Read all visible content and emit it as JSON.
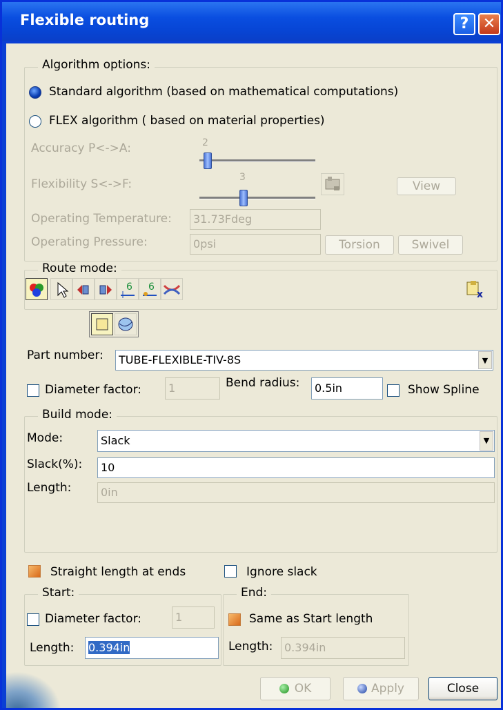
{
  "window": {
    "title": "Flexible routing",
    "help_glyph": "?",
    "close_glyph": "✕"
  },
  "algorithm": {
    "group_label": "Algorithm options:",
    "standard_label": "Standard algorithm (based on mathematical computations)",
    "flex_label": "FLEX algorithm ( based on material properties)",
    "selected": "standard",
    "accuracy_label": "Accuracy P<->A:",
    "accuracy_value": "2",
    "flexibility_label": "Flexibility S<->F:",
    "flexibility_value": "3",
    "view_button": "View",
    "temp_label": "Operating Temperature:",
    "temp_value": "31.73Fdeg",
    "pressure_label": "Operating Pressure:",
    "pressure_value": "0psi",
    "torsion_button": "Torsion",
    "swivel_button": "Swivel"
  },
  "route": {
    "group_label": "Route mode:",
    "tools": [
      "color-balls-icon",
      "select-arrow-icon",
      "speaker-left-icon",
      "speaker-right-icon",
      "point-6-icon",
      "point-6b-icon",
      "merge-icon"
    ],
    "sub_tools": [
      "square-icon",
      "sphere-icon"
    ],
    "part_number_label": "Part number:",
    "part_number_value": "TUBE-FLEXIBLE-TIV-8S",
    "diameter_factor_label": "Diameter factor:",
    "diameter_factor_value": "1",
    "bend_radius_label": "Bend radius:",
    "bend_radius_value": "0.5in",
    "show_spline_label": "Show Spline"
  },
  "build": {
    "group_label": "Build mode:",
    "mode_label": "Mode:",
    "mode_value": "Slack",
    "slack_label": "Slack(%):",
    "slack_value": "10",
    "length_label": "Length:",
    "length_value": "0in"
  },
  "ends": {
    "straight_label": "Straight length at ends",
    "ignore_slack_label": "Ignore slack",
    "start_label": "Start:",
    "start_diameter_label": "Diameter factor:",
    "start_diameter_value": "1",
    "start_length_label": "Length:",
    "start_length_value": "0.394in",
    "end_label": "End:",
    "same_as_start_label": "Same as Start length",
    "end_length_label": "Length:",
    "end_length_value": "0.394in"
  },
  "footer": {
    "ok": "OK",
    "apply": "Apply",
    "close": "Close"
  }
}
